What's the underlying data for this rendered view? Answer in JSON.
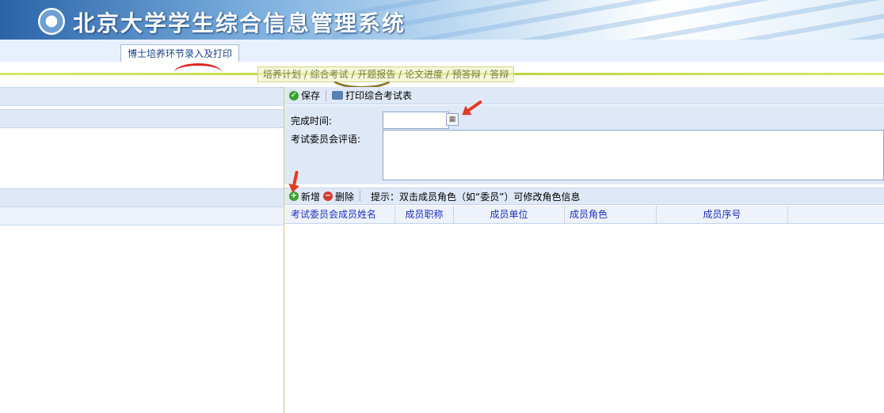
{
  "banner": {
    "title": "北京大学学生综合信息管理系统"
  },
  "tabs": [
    {
      "label": "博士培养环节录入及打印"
    }
  ],
  "subtabs": {
    "label": "培养计划 / 综合考试 / 开题报告 / 论文进度 / 预答辩 / 答辩"
  },
  "toolbar": {
    "save_label": "保存",
    "print_label": "打印综合考试表"
  },
  "form": {
    "finish_time_label": "完成时间:",
    "finish_time_value": "",
    "comment_label": "考试委员会评语:",
    "comment_value": ""
  },
  "members_toolbar": {
    "add_label": "新增",
    "delete_label": "删除",
    "hint": "提示：双击成员角色（如“委员”）可修改角色信息"
  },
  "grid": {
    "columns": [
      {
        "label": "考试委员会成员姓名",
        "align": "left"
      },
      {
        "label": "成员职称",
        "align": "center"
      },
      {
        "label": "成员单位",
        "align": "center"
      },
      {
        "label": "成员角色",
        "align": "left"
      },
      {
        "label": "成员序号",
        "align": "center"
      }
    ]
  },
  "colors": {
    "accent": "#1f2fbf",
    "toolbar_bg": "#dfe8f6",
    "annotation": "#e23a25"
  }
}
